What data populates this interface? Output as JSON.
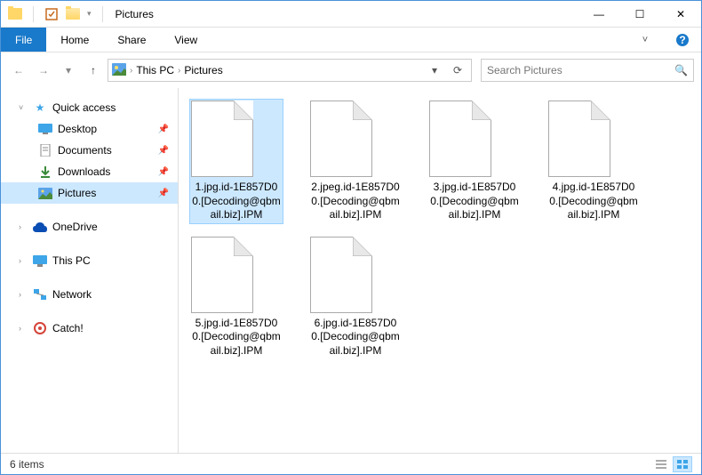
{
  "window": {
    "title": "Pictures"
  },
  "ribbon": {
    "file": "File",
    "tabs": [
      "Home",
      "Share",
      "View"
    ]
  },
  "breadcrumb": {
    "items": [
      "This PC",
      "Pictures"
    ]
  },
  "search": {
    "placeholder": "Search Pictures"
  },
  "sidebar": {
    "quick_access": "Quick access",
    "quick_items": [
      {
        "label": "Desktop",
        "pinned": true
      },
      {
        "label": "Documents",
        "pinned": true
      },
      {
        "label": "Downloads",
        "pinned": true
      },
      {
        "label": "Pictures",
        "pinned": true,
        "selected": true
      }
    ],
    "onedrive": "OneDrive",
    "this_pc": "This PC",
    "network": "Network",
    "catch": "Catch!"
  },
  "files": [
    {
      "name": "1.jpg.id-1E857D00.[Decoding@qbmail.biz].IPM",
      "selected": true
    },
    {
      "name": "2.jpeg.id-1E857D00.[Decoding@qbmail.biz].IPM"
    },
    {
      "name": "3.jpg.id-1E857D00.[Decoding@qbmail.biz].IPM"
    },
    {
      "name": "4.jpg.id-1E857D00.[Decoding@qbmail.biz].IPM"
    },
    {
      "name": "5.jpg.id-1E857D00.[Decoding@qbmail.biz].IPM"
    },
    {
      "name": "6.jpg.id-1E857D00.[Decoding@qbmail.biz].IPM"
    }
  ],
  "status": {
    "count": "6 items"
  },
  "icons": {
    "min": "—",
    "max": "☐",
    "close": "✕",
    "help": "?",
    "back": "←",
    "fwd": "→",
    "up": "↑",
    "chev_down": "▾",
    "chev_right": "›",
    "pin": "📌",
    "refresh": "⟳",
    "search": "🔍",
    "star": "★",
    "drop": "▾"
  }
}
